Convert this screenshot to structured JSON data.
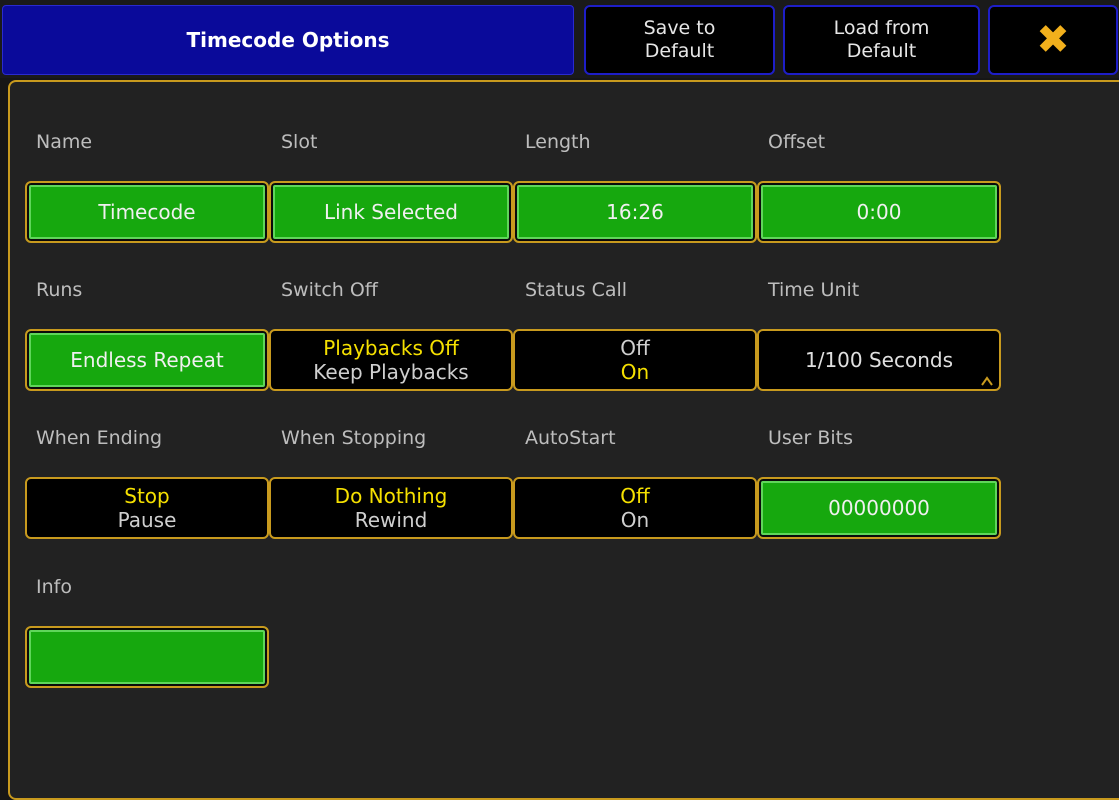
{
  "header": {
    "title": "Timecode Options",
    "save_default": "Save to\nDefault",
    "load_default": "Load from\nDefault",
    "close_glyph": "✖"
  },
  "fields": {
    "name": {
      "label": "Name",
      "value": "Timecode"
    },
    "slot": {
      "label": "Slot",
      "value": "Link Selected"
    },
    "length": {
      "label": "Length",
      "value": "16:26"
    },
    "offset": {
      "label": "Offset",
      "value": "0:00"
    },
    "runs": {
      "label": "Runs",
      "value": "Endless Repeat"
    },
    "switch_off": {
      "label": "Switch Off",
      "options": [
        "Playbacks Off",
        "Keep Playbacks"
      ],
      "selected": "Playbacks Off"
    },
    "status_call": {
      "label": "Status Call",
      "options": [
        "Off",
        "On"
      ],
      "selected": "On"
    },
    "time_unit": {
      "label": "Time Unit",
      "value": "1/100 Seconds"
    },
    "when_ending": {
      "label": "When Ending",
      "options": [
        "Stop",
        "Pause"
      ],
      "selected": "Stop"
    },
    "when_stopping": {
      "label": "When Stopping",
      "options": [
        "Do Nothing",
        "Rewind"
      ],
      "selected": "Do Nothing"
    },
    "autostart": {
      "label": "AutoStart",
      "options": [
        "Off",
        "On"
      ],
      "selected": "Off"
    },
    "user_bits": {
      "label": "User Bits",
      "value": "00000000"
    },
    "info": {
      "label": "Info",
      "value": ""
    }
  },
  "colors": {
    "accent_border": "#c89a1e",
    "active_option": "#f5e000",
    "field_green": "#16a80e",
    "title_blue": "#0a0a9a"
  }
}
